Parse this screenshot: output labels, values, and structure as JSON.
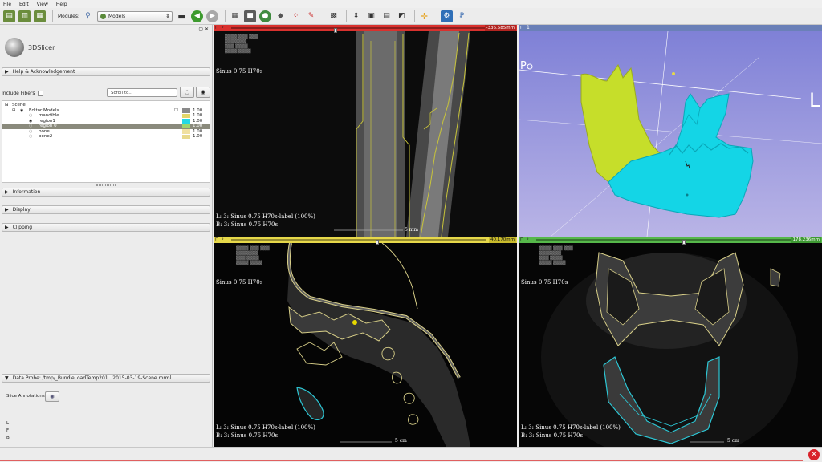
{
  "menu": [
    "File",
    "Edit",
    "View",
    "Help"
  ],
  "toolbar": {
    "modules_label": "Modules:",
    "module_selected": "Models",
    "icons": [
      "data-icon",
      "dcm-icon",
      "save-icon",
      "search-icon",
      "layout-icon",
      "back-arrow-icon",
      "forward-arrow-icon",
      "grid-icon",
      "cube-icon",
      "globe-icon",
      "shapes-icon",
      "dots-icon",
      "pen-icon",
      "layout-grid-icon",
      "crosshair-icon",
      "python-icon"
    ]
  },
  "left_panel": {
    "app_name": "3DSlicer",
    "help_section": "Help & Acknowledgement",
    "include_fibers_label": "Include Fibers",
    "scroll_to_placeholder": "Scroll to...",
    "tree": {
      "root": "Scene",
      "group": "Editor Models",
      "items": [
        {
          "name": "mandible",
          "opacity": "1.00",
          "color": "#e3d66a"
        },
        {
          "name": "region1",
          "opacity": "1.00",
          "color": "#23d8e6"
        },
        {
          "name": "region 0",
          "opacity": "1.00",
          "color": "#9ed36d"
        },
        {
          "name": "bone",
          "opacity": "1.00",
          "color": "#f0e0a0"
        },
        {
          "name": "bone2",
          "opacity": "1.00",
          "color": "#e8d98c"
        }
      ],
      "group_opacity": "1.00"
    },
    "sections": [
      "Information",
      "Display",
      "Clipping"
    ],
    "data_probe": "Data Probe: /tmp/_BundleLoadTemp201...2015-03-19-Scene.mrml",
    "slice_annotations_label": "Slice Annotations:",
    "probe_rows": [
      "L",
      "F",
      "B"
    ]
  },
  "views": {
    "red": {
      "offset": "-336.585mm",
      "bar_color": "#d9312e",
      "title": "Sinus  0.75  H70s",
      "line_l": "L: 3: Sinus  0.75  H70s-label (100%)",
      "line_b": "B: 3: Sinus  0.75  H70s",
      "scale": "5 mm"
    },
    "three_d": {
      "number": "1",
      "bar_color": "#6a80b8",
      "left_marker": "P",
      "right_marker": "L"
    },
    "yellow": {
      "offset": "40.170mm",
      "bar_color": "#e6d84a",
      "title": "Sinus  0.75  H70s",
      "line_l": "L: 3: Sinus  0.75  H70s-label (100%)",
      "line_b": "B: 3: Sinus  0.75  H70s",
      "scale": "5 cm"
    },
    "green": {
      "offset": "178.236mm",
      "bar_color": "#56b84a",
      "title": "Sinus  0.75  H70s",
      "line_l": "L: 3: Sinus  0.75  H70s-label (100%)",
      "line_b": "B: 3: Sinus  0.75  H70s",
      "scale": "5 cm"
    }
  }
}
